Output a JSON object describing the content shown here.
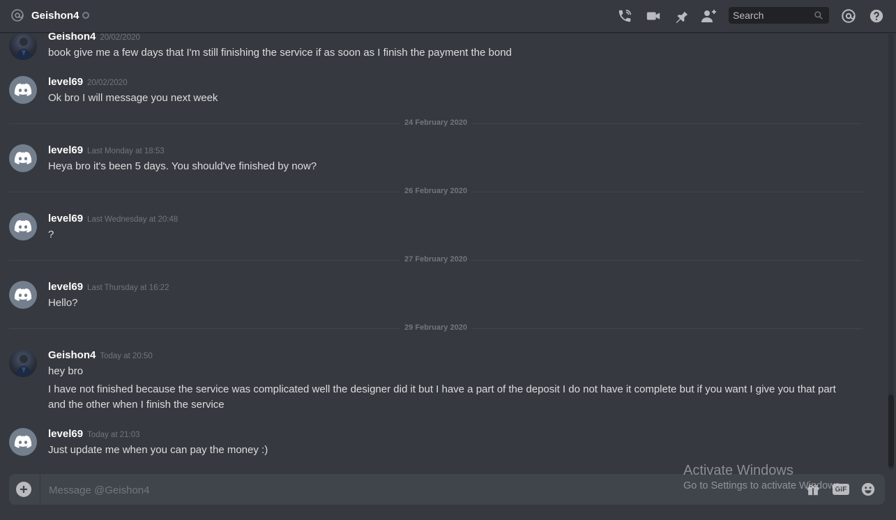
{
  "header": {
    "channel_name": "Geishon4",
    "search_placeholder": "Search",
    "icons": [
      "at-icon",
      "call-icon",
      "video-icon",
      "pin-icon",
      "add-friend-icon",
      "search-icon",
      "mention-icon",
      "help-icon"
    ]
  },
  "messages": [
    {
      "author": "Geishon4",
      "timestamp": "20/02/2020",
      "avatar": "photo",
      "lines": [
        "book give me a few days that I'm still finishing the service if as soon as I finish the payment the bond"
      ]
    },
    {
      "author": "level69",
      "timestamp": "20/02/2020",
      "avatar": "discord",
      "lines": [
        "Ok bro I will message you next week"
      ]
    },
    {
      "author": "level69",
      "timestamp": "Last Monday at 18:53",
      "avatar": "discord",
      "lines": [
        "Heya bro it's been 5 days. You should've finished by now?"
      ]
    },
    {
      "author": "level69",
      "timestamp": "Last Wednesday at 20:48",
      "avatar": "discord",
      "lines": [
        "?"
      ]
    },
    {
      "author": "level69",
      "timestamp": "Last Thursday at 16:22",
      "avatar": "discord",
      "lines": [
        "Hello?"
      ]
    },
    {
      "author": "Geishon4",
      "timestamp": "Today at 20:50",
      "avatar": "photo",
      "lines": [
        "hey bro",
        "I have not finished because the service was complicated well the designer did it but I have a part of the deposit I do not have it complete but if you want I give you that part and the other when I finish the service"
      ]
    },
    {
      "author": "level69",
      "timestamp": "Today at 21:03",
      "avatar": "discord",
      "lines": [
        "Just update me when you can pay the money :)"
      ]
    }
  ],
  "dividers": [
    "24 February 2020",
    "26 February 2020",
    "27 February 2020",
    "29 February 2020"
  ],
  "composer": {
    "placeholder": "Message @Geishon4",
    "gif_label": "GIF"
  },
  "watermark": {
    "title": "Activate Windows",
    "subtitle": "Go to Settings to activate Windows."
  },
  "colors": {
    "background": "#36393f",
    "composer": "#40444b",
    "avatar_default": "#747f8d",
    "timestamp": "#72767d"
  }
}
